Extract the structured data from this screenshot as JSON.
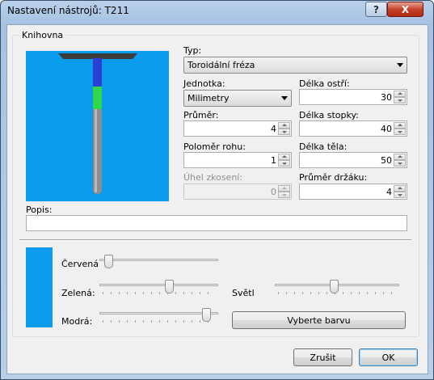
{
  "window": {
    "title": "Nastavení nástrojů: T211",
    "help_glyph": "?",
    "close_glyph": "X"
  },
  "library": {
    "group_label": "Knihovna",
    "type_label": "Typ:",
    "type_value": "Toroidální fréza",
    "unit_label": "Jednotka:",
    "unit_value": "Milimetry",
    "diameter_label": "Průměr:",
    "diameter_value": "4",
    "corner_radius_label": "Poloměr rohu:",
    "corner_radius_value": "1",
    "bevel_angle_label": "Úhel zkosení:",
    "bevel_angle_value": "0",
    "flute_length_label": "Délka ostří:",
    "flute_length_value": "30",
    "shank_length_label": "Délka stopky:",
    "shank_length_value": "40",
    "body_length_label": "Délka těla:",
    "body_length_value": "50",
    "holder_diameter_label": "Průměr držáku:",
    "holder_diameter_value": "4",
    "description_label": "Popis:",
    "description_value": ""
  },
  "color": {
    "red_label": "Červená",
    "green_label": "Zelená:",
    "blue_label": "Modrá:",
    "brightness_label": "Světlost",
    "red_level": 0.04,
    "green_level": 0.59,
    "blue_level": 0.93,
    "brightness_level": 0.47,
    "choose_color_label": "Vyberte barvu",
    "swatch_color": "#0a9bec"
  },
  "tool_colors": {
    "background": "#0a9bec",
    "holder": "#3c3c3c",
    "shank": "#2b3fd4",
    "flute": "#2fd846",
    "body": "#8d8d8d"
  },
  "footer": {
    "cancel_label": "Zrušit",
    "ok_label": "OK"
  }
}
